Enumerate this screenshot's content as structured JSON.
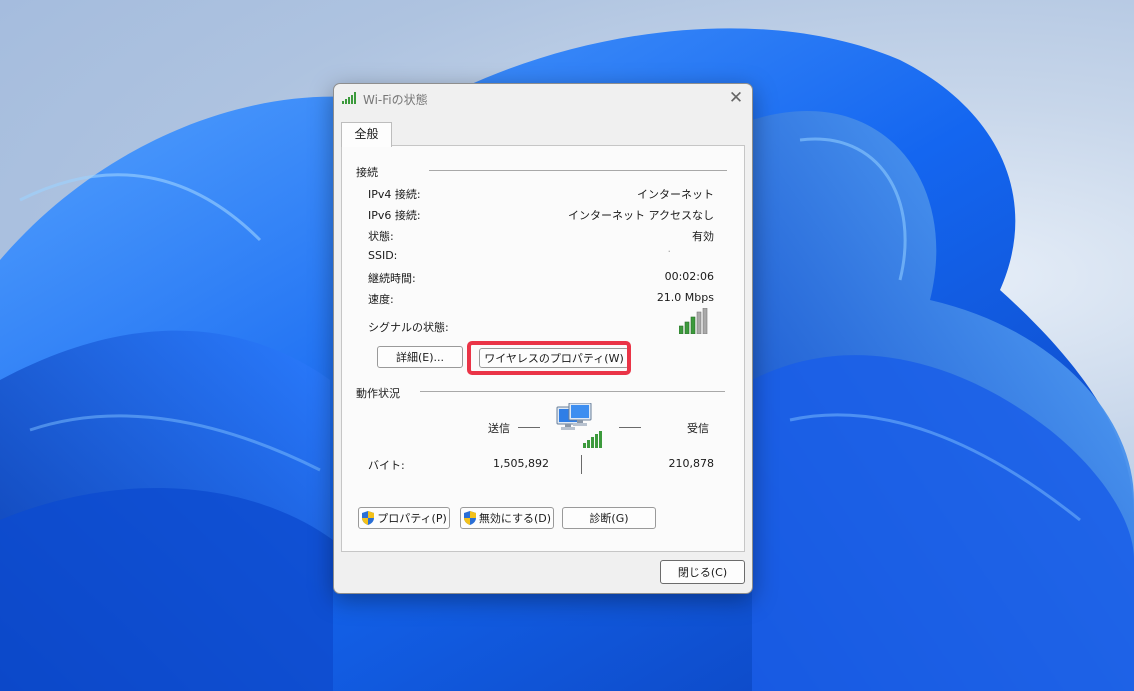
{
  "window": {
    "title": "Wi-Fiの状態",
    "tab_label": "全般"
  },
  "connection": {
    "group_label": "接続",
    "rows": [
      {
        "label": "IPv4 接続:",
        "value": "インターネット"
      },
      {
        "label": "IPv6 接続:",
        "value": "インターネット アクセスなし"
      },
      {
        "label": "状態:",
        "value": "有効"
      },
      {
        "label": "SSID:",
        "value": "."
      },
      {
        "label": "継続時間:",
        "value": "00:02:06"
      },
      {
        "label": "速度:",
        "value": "21.0 Mbps"
      }
    ],
    "signal_label": "シグナルの状態:",
    "details_button": "詳細(E)...",
    "wireless_properties_button": "ワイヤレスのプロパティ(W)"
  },
  "activity": {
    "group_label": "動作状況",
    "sent_label": "送信",
    "received_label": "受信",
    "bytes_label": "バイト:",
    "bytes_sent": "1,505,892",
    "bytes_received": "210,878"
  },
  "buttons": {
    "properties": "プロパティ(P)",
    "disable": "無効にする(D)",
    "diagnose": "診断(G)",
    "close": "閉じる(C)"
  },
  "icons": {
    "title": "wifi-signal-icon",
    "signal": "signal-bars-icon",
    "network": "network-computers-icon",
    "shield": "uac-shield-icon",
    "close": "close-icon"
  },
  "colors": {
    "highlight": "#ea3447",
    "signal_green": "#3c9a3c",
    "wallpaper_blue": "#1d5ce0"
  }
}
